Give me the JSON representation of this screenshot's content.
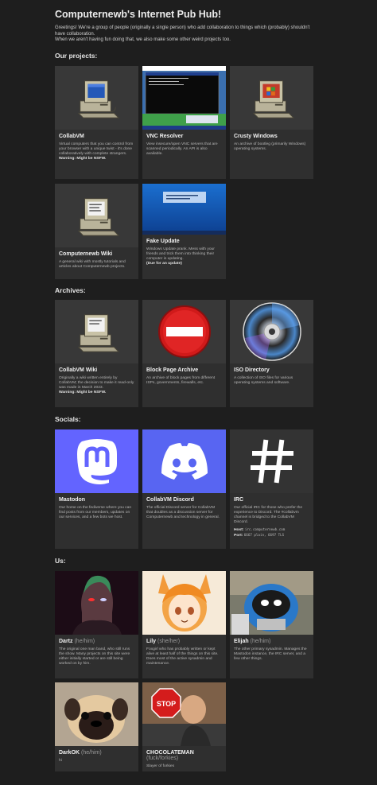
{
  "title": "Computernewb's Internet Pub Hub!",
  "intro": {
    "line1": "Greetings! We're a group of people (originally a single person) who add collaboration to things which (probably) shouldn't have collaboration.",
    "line2": "When we aren't having fun doing that, we also make some other weird projects too."
  },
  "sections": {
    "projects": "Our projects:",
    "archives": "Archives:",
    "socials": "Socials:",
    "us": "Us:"
  },
  "projects": [
    {
      "icon": "retro-computer-icon",
      "title": "CollabVM",
      "desc": "Virtual computers that you can control from your browser with a unique twist - it's done collaboratively with complete strangers.",
      "warning": "Warning: Might be NSFW."
    },
    {
      "icon": "vnc-screenshot",
      "title": "VNC Resolver",
      "desc": "View insecure/open VNC servers that are scanned periodically. An API is also available."
    },
    {
      "icon": "retro-computer-icon",
      "title": "Crusty Windows",
      "desc": "An archive of bootleg (primarily Windows) operating systems."
    },
    {
      "icon": "retro-computer-icon",
      "title": "Computernewb Wiki",
      "desc": "A general wiki with mostly tutorials and articles about Computernewb projects."
    },
    {
      "icon": "windows-update-screenshot",
      "title": "Fake Update",
      "desc": "Windows Update prank. Mess with your friends and trick them into thinking their computer is updating.",
      "note": "(Due for an update)"
    }
  ],
  "archives": [
    {
      "icon": "retro-computer-icon",
      "title": "CollabVM Wiki",
      "desc": "Originally a wiki written entirely by CollabVM; the decision to make it read-only was made in March 2023.",
      "warning": "Warning: Might be NSFW."
    },
    {
      "icon": "block-sign-icon",
      "title": "Block Page Archive",
      "desc": "An archive of block pages from different ISPs, governments, firewalls, etc."
    },
    {
      "icon": "cd-disc-icon",
      "title": "ISO Directory",
      "desc": "A collection of ISO files for various operating systems and software."
    }
  ],
  "socials": [
    {
      "icon": "mastodon-icon",
      "title": "Mastodon",
      "desc": "Our home on the fediverse where you can find posts from our members, updates on our services, and a few bots we host.",
      "bg": "#6364ff"
    },
    {
      "icon": "discord-icon",
      "title": "CollabVM Discord",
      "desc": "The official Discord server for CollabVM that doubles as a discussion server for Computernewb and technology in general.",
      "bg": "#5865f2"
    },
    {
      "icon": "hash-icon",
      "title": "IRC",
      "desc": "Our official IRC for those who prefer the experience to Discord. The #collabvm channel is bridged to the CollabVM Discord.",
      "host_label": "Host:",
      "host": "irc.computernewb.com",
      "port_label": "Port:",
      "port": "6667 plain, 6697 TLS",
      "bg": "#333333"
    }
  ],
  "members": [
    {
      "name": "Dartz",
      "pronouns": "(he/him)",
      "desc": "The original one man band, who still runs the show. Many projects on this site were either initially started or are still being worked on by him."
    },
    {
      "name": "Lily",
      "pronouns": "(she/her)",
      "desc": "Foxgirl who has probably written or kept alive at least half of the things on this site. Does most of the active sysadmin and maintenance."
    },
    {
      "name": "Elijah",
      "pronouns": "(he/him)",
      "desc": "The other primary sysadmin. Manages the Mastodon instance, the IRC server, and a few other things."
    },
    {
      "name": "DarkOK",
      "pronouns": "(he/him)",
      "desc": "hi"
    },
    {
      "name": "CHOCOLATEMAN",
      "pronouns": "(fuck/forkies)",
      "desc": "Slayer of forkies"
    }
  ],
  "colors": {
    "background": "#1e1e1e",
    "card": "#2f2f2f",
    "thumb": "#383838",
    "mastodon": "#6364ff",
    "discord": "#5865f2"
  }
}
